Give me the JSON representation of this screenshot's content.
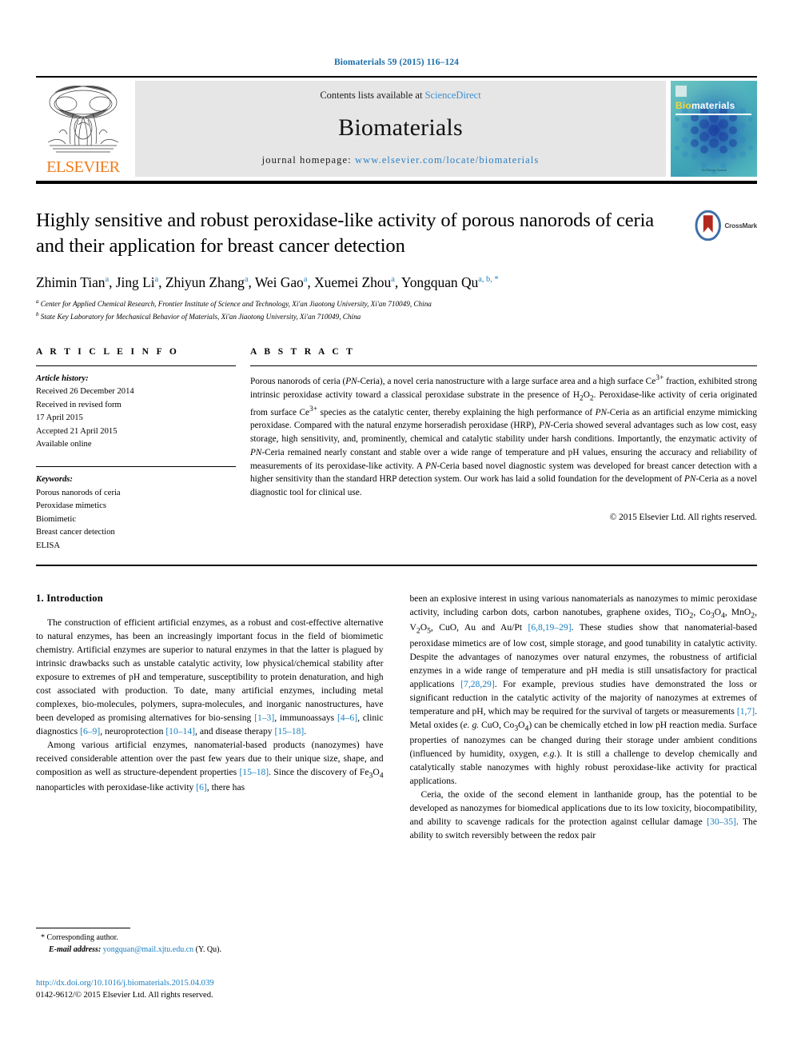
{
  "running_head": "Biomaterials 59 (2015) 116–124",
  "masthead": {
    "contents_prefix": "Contents lists available at ",
    "sciencedirect": "ScienceDirect",
    "journal_name": "Biomaterials",
    "homepage_prefix": "journal homepage: ",
    "homepage_url": "www.elsevier.com/locate/biomaterials",
    "publisher": "ELSEVIER",
    "cover": {
      "title_first": "Bio",
      "title_rest": "materials",
      "footer": "An Elsevier Journal"
    }
  },
  "article": {
    "title": "Highly sensitive and robust peroxidase-like activity of porous nanorods of ceria and their application for breast cancer detection",
    "authors": [
      {
        "name": "Zhimin Tian",
        "sup": "a",
        "sep": ", "
      },
      {
        "name": "Jing Li",
        "sup": "a",
        "sep": ", "
      },
      {
        "name": "Zhiyun Zhang",
        "sup": "a",
        "sep": ", "
      },
      {
        "name": "Wei Gao",
        "sup": "a",
        "sep": ", "
      },
      {
        "name": "Xuemei Zhou",
        "sup": "a",
        "sep": ", "
      },
      {
        "name": "Yongquan Qu",
        "sup": "a, b, *",
        "sep": ""
      }
    ],
    "affiliations": [
      {
        "mark": "a",
        "text": "Center for Applied Chemical Research, Frontier Institute of Science and Technology, Xi'an Jiaotong University, Xi'an 710049, China"
      },
      {
        "mark": "b",
        "text": "State Key Laboratory for Mechanical Behavior of Materials, Xi'an Jiaotong University, Xi'an 710049, China"
      }
    ],
    "crossmark_label": "CrossMark"
  },
  "article_info": {
    "heading": "A R T I C L E  I N F O",
    "history_label": "Article history:",
    "history": [
      "Received 26 December 2014",
      "Received in revised form",
      "17 April 2015",
      "Accepted 21 April 2015",
      "Available online"
    ],
    "keywords_label": "Keywords:",
    "keywords": [
      "Porous nanorods of ceria",
      "Peroxidase mimetics",
      "Biomimetic",
      "Breast cancer detection",
      "ELISA"
    ]
  },
  "abstract": {
    "heading": "A B S T R A C T",
    "copyright": "© 2015 Elsevier Ltd. All rights reserved."
  },
  "intro": {
    "heading": "1.  Introduction"
  },
  "footnote": {
    "corresponding": "* Corresponding author.",
    "email_label": "E-mail address:",
    "email": "yongquan@mail.xjtu.edu.cn",
    "email_owner": "(Y. Qu)."
  },
  "footer": {
    "doi": "http://dx.doi.org/10.1016/j.biomaterials.2015.04.039",
    "issn_line": "0142-9612/© 2015 Elsevier Ltd. All rights reserved."
  },
  "colors": {
    "link": "#1a7fc1",
    "elsevier_orange": "#f07c1a",
    "masthead_gray": "#e6e6e6"
  }
}
